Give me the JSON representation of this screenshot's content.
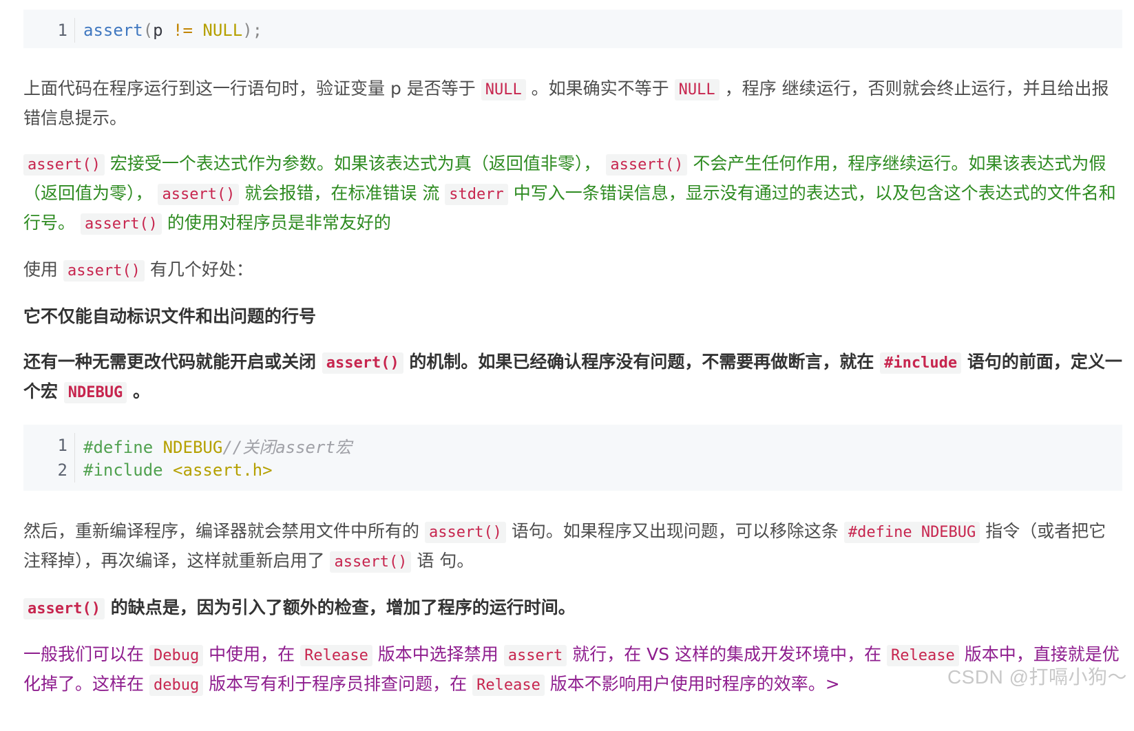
{
  "code_block_1": {
    "lines": [
      {
        "num": "1",
        "tokens": [
          "assert",
          "(",
          "p",
          " != ",
          "NULL",
          ");"
        ]
      }
    ]
  },
  "para_1": {
    "t1": "上面代码在程序运行到这一行语句时，验证变量 p 是否等于",
    "c1": "NULL",
    "t2": "。如果确实不等于",
    "c2": "NULL",
    "t3": "，程序 继续运行，否则就会终止运行，并且给出报错信息提示。"
  },
  "para_2": {
    "c1": "assert()",
    "t1": "宏接受一个表达式作为参数。如果该表达式为真（返回值非零），",
    "c2": "assert()",
    "t2": "不会产生任何作用，程序继续运行。如果该表达式为假（返回值为零），",
    "c3": "assert()",
    "t3": "就会报错，在标准错误 流",
    "c4": "stderr",
    "t4": "中写入一条错误信息，显示没有通过的表达式，以及包含这个表达式的文件名和行号。",
    "c5": "assert()",
    "t5": "的使用对程序员是非常友好的"
  },
  "para_3": {
    "t1": "使用",
    "c1": "assert()",
    "t2": "有几个好处："
  },
  "para_4": {
    "t1": "它不仅能自动标识文件和出问题的行号"
  },
  "para_5": {
    "t1": "还有一种无需更改代码就能开启或关闭",
    "c1": "assert()",
    "t2": "的机制。如果已经确认程序没有问题，不需要再做断言，就在",
    "c2": "#include",
    "t3": "语句的前面，定义一个宏",
    "c3": "NDEBUG",
    "t4": "。"
  },
  "code_block_2": {
    "lines": [
      {
        "num": "1",
        "define": "#define",
        "ident": " NDEBUG",
        "comment": "//关闭assert宏"
      },
      {
        "num": "2",
        "define": "#include",
        "path": " <assert.h>"
      }
    ]
  },
  "para_6": {
    "t1": "然后，重新编译程序，编译器就会禁用文件中所有的",
    "c1": "assert()",
    "t2": "语句。如果程序又出现问题，可以移除这条",
    "c2": "#define NDEBUG",
    "t3": "指令（或者把它注释掉），再次编译，这样就重新启用了",
    "c3": "assert()",
    "t4": "语 句。"
  },
  "para_7": {
    "c1": "assert()",
    "t1": "的缺点是，因为引入了额外的检查，增加了程序的运行时间。"
  },
  "para_8": {
    "t1": "一般我们可以在",
    "c1": "Debug",
    "t2": "中使用，在",
    "c2": "Release",
    "t3": "版本中选择禁用",
    "c3": "assert",
    "t4": "就行，在 VS 这样的集成开发环境中，在",
    "c4": "Release",
    "t5": "版本中，直接就是优化掉了。这样在",
    "c5": "debug",
    "t6": "版本写有利于程序员排查问题，在",
    "c6": "Release",
    "t7": "版本不影响用户使用时程序的效率。>"
  },
  "watermark": "CSDN @打嗝小狗～",
  "colors": {
    "inline_code": "#c7254e",
    "green_text": "#2e8b21",
    "purple_text": "#8e1d8e",
    "code_bg": "#f6f8fa"
  }
}
